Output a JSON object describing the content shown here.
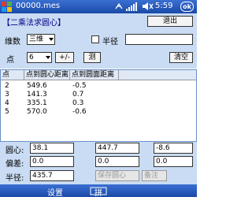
{
  "titlebar": {
    "app_title": "00000.mes",
    "time": "5:59",
    "ok_label": "ok"
  },
  "panel": {
    "header": "【二乘法求圆心】",
    "exit_label": "退出",
    "dimension_label": "维数",
    "dimension_value": "三维",
    "radius_check_label": "半径",
    "radius_value": "",
    "point_label": "点",
    "point_value": "6",
    "plus_minus_label": "+/-",
    "measure_label": "测",
    "clear_label": "清空"
  },
  "table": {
    "columns": [
      "点",
      "点到圆心距离",
      "点到圆面距离"
    ],
    "rows": [
      [
        "2",
        "549.6",
        "-0.5"
      ],
      [
        "3",
        "141.3",
        "0.7"
      ],
      [
        "4",
        "335.1",
        "0.3"
      ],
      [
        "5",
        "570.0",
        "-0.6"
      ]
    ]
  },
  "results": {
    "center_label": "圆心:",
    "center_x": "38.1",
    "center_y": "447.7",
    "center_z": "-8.6",
    "deviation_label": "偏差:",
    "dev_x": "0.0",
    "dev_y": "0.0",
    "dev_z": "0.0",
    "radius_label": "半径:",
    "radius_value": "435.7",
    "save_center_label": "保存圆心",
    "note_label": "备注"
  },
  "softkeys": {
    "left": "设置",
    "middle": "拼"
  },
  "colors": {
    "titlebar": "#1a4aa8",
    "panel": "#c9dcf3",
    "header_text": "#00008b"
  }
}
